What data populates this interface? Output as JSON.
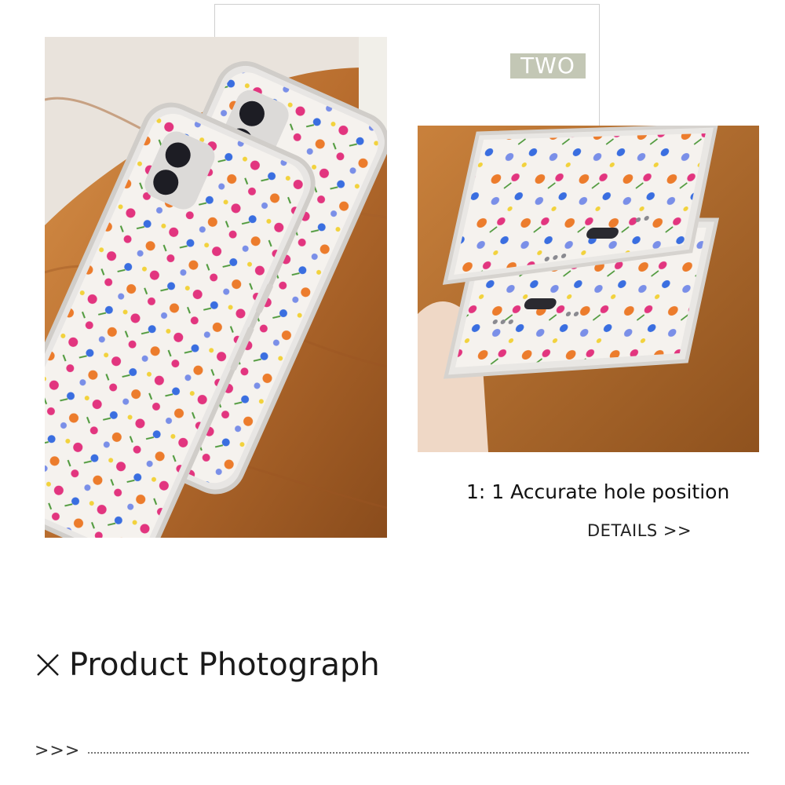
{
  "tag": {
    "label": "TWO"
  },
  "photos": {
    "left": {
      "icon": "phone-cases-photo"
    },
    "right": {
      "icon": "phone-cases-bottom-photo"
    }
  },
  "caption": {
    "text": "1: 1 Accurate hole position"
  },
  "details": {
    "label": "DETAILS >>"
  },
  "section": {
    "title": "Product Photograph",
    "icon": "close-icon"
  },
  "footer": {
    "arrows": ">>>"
  },
  "colors": {
    "tag_bg": "#c3c7b5",
    "wood": "#c07a36",
    "case": "#f4f1ee",
    "petal_pink": "#e2357f",
    "petal_blue": "#3a6ee0",
    "petal_orange": "#ec7c2c",
    "leaf_green": "#4f9a3c"
  }
}
